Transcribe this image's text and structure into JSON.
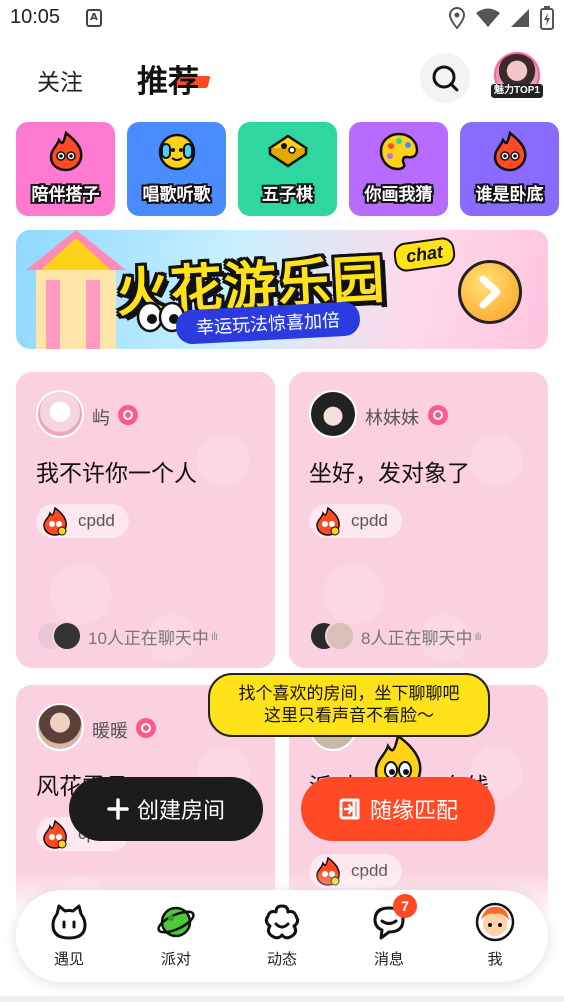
{
  "status_bar": {
    "time": "10:05",
    "notification_letter": "A"
  },
  "top_nav": {
    "tabs": [
      {
        "label": "关注"
      },
      {
        "label": "推荐"
      }
    ],
    "avatar_badge": "魅力TOP1"
  },
  "categories": [
    {
      "label": "陪伴搭子",
      "color": "#ff7ad0",
      "icon": "flame-mascot-icon"
    },
    {
      "label": "唱歌听歌",
      "color": "#4a8cff",
      "icon": "singing-mascot-icon"
    },
    {
      "label": "五子棋",
      "color": "#2ed6a0",
      "icon": "gomoku-board-icon"
    },
    {
      "label": "你画我猜",
      "color": "#b86bff",
      "icon": "paint-palette-icon"
    },
    {
      "label": "谁是卧底",
      "color": "#8a6bff",
      "icon": "spy-mascot-icon"
    }
  ],
  "banner": {
    "title": "火花游乐园",
    "chip": "chat",
    "subtitle": "幸运玩法惊喜加倍"
  },
  "rooms": [
    {
      "host": "屿",
      "title": "我不许你一个人",
      "tag": "cpdd",
      "online": "10人正在聊天中",
      "avatar_color": "#f6d5e0"
    },
    {
      "host": "林妹妹",
      "title": "坐好，发对象了",
      "tag": "cpdd",
      "online": "8人正在聊天中",
      "avatar_color": "#2a2a2a"
    },
    {
      "host": "暖暖",
      "title": "风花雪月",
      "tag": "cpdd",
      "avatar_color": "#d8b8a8"
    },
    {
      "host": "",
      "title": "派对",
      "title_end": "在线",
      "tag": "cpdd",
      "avatar_color": "#e8d8c8"
    }
  ],
  "tooltip": {
    "line1": "找个喜欢的房间，坐下聊聊吧",
    "line2": "这里只看声音不看脸～"
  },
  "actions": {
    "create_label": "创建房间",
    "match_label": "随缘匹配"
  },
  "bottom_nav": [
    {
      "label": "遇见",
      "icon": "meet-icon"
    },
    {
      "label": "派对",
      "icon": "party-planet-icon"
    },
    {
      "label": "动态",
      "icon": "moments-flower-icon"
    },
    {
      "label": "消息",
      "icon": "message-bubble-icon",
      "badge": "7"
    },
    {
      "label": "我",
      "icon": "profile-avatar-icon"
    }
  ],
  "colors": {
    "accent": "#ff4a25",
    "card_pink": "#fbd0e0",
    "yellow": "#ffe21a"
  }
}
